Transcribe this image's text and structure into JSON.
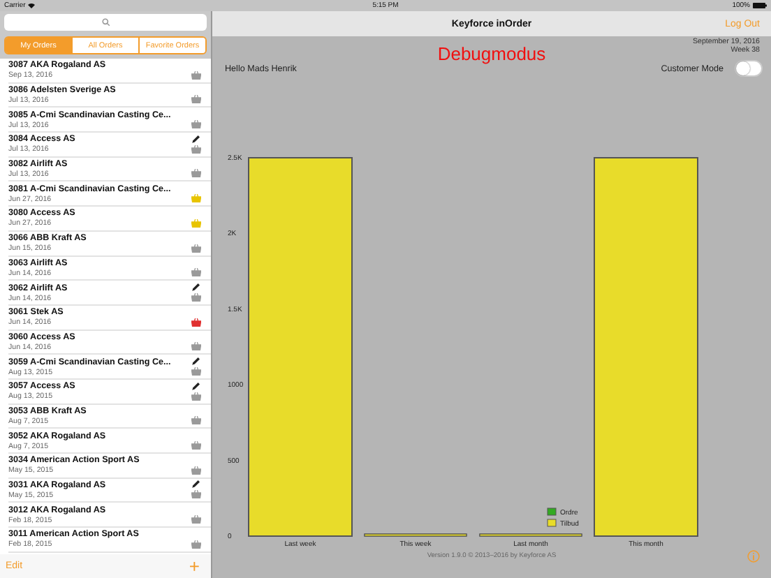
{
  "status_bar": {
    "carrier": "Carrier",
    "time": "5:15 PM",
    "battery": "100%"
  },
  "tabs": [
    {
      "label": "My Orders",
      "selected": true
    },
    {
      "label": "All Orders",
      "selected": false
    },
    {
      "label": "Favorite Orders",
      "selected": false
    }
  ],
  "orders": [
    {
      "title": "3087 AKA Rogaland AS",
      "date": "Sep 13, 2016",
      "edited": false,
      "color": "#9a9a9a"
    },
    {
      "title": "3086 Adelsten Sverige AS",
      "date": "Jul 13, 2016",
      "edited": false,
      "color": "#9a9a9a"
    },
    {
      "title": "3085 A-Cmi Scandinavian Casting Ce...",
      "date": "Jul 13, 2016",
      "edited": false,
      "color": "#9a9a9a"
    },
    {
      "title": "3084 Access AS",
      "date": "Jul 13, 2016",
      "edited": true,
      "color": "#9a9a9a"
    },
    {
      "title": "3082 Airlift AS",
      "date": "Jul 13, 2016",
      "edited": false,
      "color": "#9a9a9a"
    },
    {
      "title": "3081 A-Cmi Scandinavian Casting Ce...",
      "date": "Jun 27, 2016",
      "edited": false,
      "color": "#e8c400"
    },
    {
      "title": "3080 Access AS",
      "date": "Jun 27, 2016",
      "edited": false,
      "color": "#e8c400"
    },
    {
      "title": "3066 ABB Kraft AS",
      "date": "Jun 15, 2016",
      "edited": false,
      "color": "#9a9a9a"
    },
    {
      "title": "3063 Airlift AS",
      "date": "Jun 14, 2016",
      "edited": false,
      "color": "#9a9a9a"
    },
    {
      "title": "3062 Airlift AS",
      "date": "Jun 14, 2016",
      "edited": true,
      "color": "#9a9a9a"
    },
    {
      "title": "3061 Stek AS",
      "date": "Jun 14, 2016",
      "edited": false,
      "color": "#e03030"
    },
    {
      "title": "3060 Access AS",
      "date": "Jun 14, 2016",
      "edited": false,
      "color": "#9a9a9a"
    },
    {
      "title": "3059 A-Cmi Scandinavian Casting Ce...",
      "date": "Aug 13, 2015",
      "edited": true,
      "color": "#9a9a9a"
    },
    {
      "title": "3057 Access AS",
      "date": "Aug 13, 2015",
      "edited": true,
      "color": "#9a9a9a"
    },
    {
      "title": "3053 ABB Kraft AS",
      "date": "Aug 7, 2015",
      "edited": false,
      "color": "#9a9a9a"
    },
    {
      "title": "3052 AKA Rogaland AS",
      "date": "Aug 7, 2015",
      "edited": false,
      "color": "#9a9a9a"
    },
    {
      "title": "3034 American Action Sport AS",
      "date": "May 15, 2015",
      "edited": false,
      "color": "#9a9a9a"
    },
    {
      "title": "3031 AKA Rogaland AS",
      "date": "May 15, 2015",
      "edited": true,
      "color": "#9a9a9a"
    },
    {
      "title": "3012 AKA Rogaland AS",
      "date": "Feb 18, 2015",
      "edited": false,
      "color": "#9a9a9a"
    },
    {
      "title": "3011 American Action Sport AS",
      "date": "Feb 18, 2015",
      "edited": false,
      "color": "#9a9a9a"
    }
  ],
  "list_footer": {
    "edit": "Edit",
    "add": "+"
  },
  "nav_bar": {
    "title": "Keyforce inOrder",
    "logout": "Log Out"
  },
  "header": {
    "debug": "Debugmodus",
    "date": "September 19, 2016",
    "week": "Week 38",
    "greeting": "Hello Mads Henrik",
    "customer_mode": {
      "label": "Customer Mode",
      "on": false
    }
  },
  "chart": {
    "chart_data": {
      "type": "bar",
      "stacked": true,
      "categories": [
        "Last week",
        "This week",
        "Last month",
        "This month"
      ],
      "series": [
        {
          "name": "Ordre",
          "color": "#33aa22",
          "values": [
            0,
            0,
            0,
            0
          ]
        },
        {
          "name": "Tilbud",
          "color": "#e8dc2a",
          "values": [
            2500,
            0,
            0,
            2500
          ]
        }
      ],
      "legend": "lower right",
      "ylim": [
        0,
        2500
      ],
      "yticks": [
        0,
        {
          "value": 500,
          "label": "500"
        },
        {
          "value": 1000,
          "label": "1000"
        },
        {
          "value": 1500,
          "label": "1.5K"
        },
        {
          "value": 2000,
          "label": "2K"
        },
        {
          "value": 2500,
          "label": "2.5K"
        }
      ]
    }
  },
  "footer": {
    "version": "Version 1.9.0 © 2013–2016 by Keyforce AS"
  }
}
